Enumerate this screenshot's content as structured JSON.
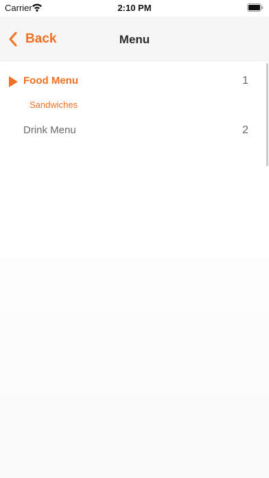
{
  "status_bar": {
    "carrier": "Carrier",
    "time": "2:10 PM"
  },
  "nav": {
    "back_label": "Back",
    "title": "Menu"
  },
  "menu": {
    "sections": [
      {
        "label": "Food Menu",
        "count": "1",
        "expanded": true,
        "items": [
          {
            "label": "Sandwiches"
          }
        ]
      },
      {
        "label": "Drink Menu",
        "count": "2",
        "expanded": false,
        "items": []
      }
    ]
  },
  "colors": {
    "accent": "#f36f21",
    "nav_background": "#f6f6f7",
    "inactive_text": "#6b6b6b"
  },
  "icons": {
    "back": "chevron-left-icon",
    "expanded": "triangle-right-icon",
    "wifi": "wifi-icon",
    "battery": "battery-icon"
  }
}
